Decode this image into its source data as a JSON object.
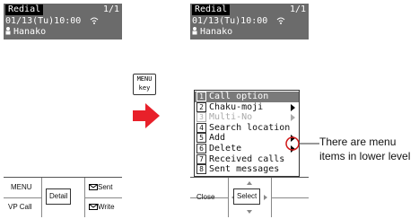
{
  "left_screen": {
    "tag": "Redial",
    "page": "1/1",
    "datetime": "01/13(Tu)10:00",
    "name": "Hanako",
    "softkeys": {
      "menu": "MENU",
      "vp_call": "VP Call",
      "center": "Detail",
      "sent": "Sent",
      "write": "Write"
    }
  },
  "right_screen": {
    "tag": "Redial",
    "page": "1/1",
    "datetime": "01/13(Tu)10:00",
    "name": "Hanako",
    "menu": [
      {
        "num": "1",
        "label": "Call option"
      },
      {
        "num": "2",
        "label": "Chaku-moji"
      },
      {
        "num": "3",
        "label": "Multi-No"
      },
      {
        "num": "4",
        "label": "Search location"
      },
      {
        "num": "5",
        "label": "Add"
      },
      {
        "num": "6",
        "label": "Delete"
      },
      {
        "num": "7",
        "label": "Received calls"
      },
      {
        "num": "8",
        "label": "Sent messages"
      }
    ],
    "softkeys": {
      "close": "Close",
      "center": "Select"
    }
  },
  "key_icon": {
    "line1": "MENU",
    "line2": "key"
  },
  "callout": "There are menu items in lower level",
  "colors": {
    "header": "#6b6b6b",
    "arrow": "#e8202a",
    "selected": "#7a7a7a"
  }
}
